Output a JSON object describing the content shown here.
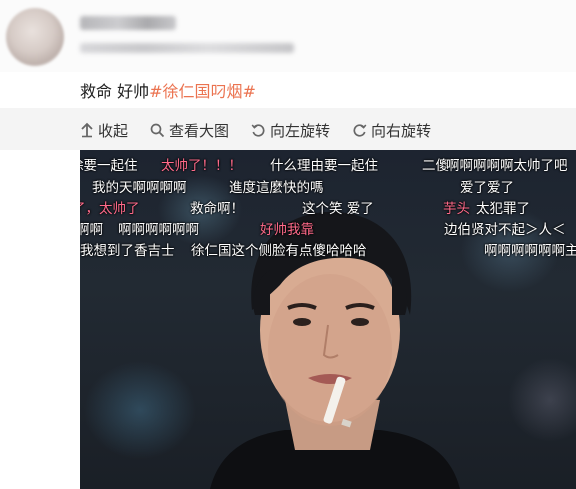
{
  "post": {
    "text": "救命 好帅",
    "hashtag": "#徐仁国叼烟#"
  },
  "toolbar": {
    "collapse_label": "收起",
    "view_large_label": "查看大图",
    "rotate_left_label": "向左旋转",
    "rotate_right_label": "向右旋转",
    "icons": [
      "arrow-up-icon",
      "magnifier-icon",
      "rotate-left-icon",
      "rotate-right-icon"
    ]
  },
  "danmaku": [
    {
      "text": "除要一起住",
      "color": "#ffffff"
    },
    {
      "text": "太帅了！！！",
      "color": "#ff6a8a"
    },
    {
      "text": "什么理由要一起住",
      "color": "#ffffff"
    },
    {
      "text": "二傻",
      "color": "#ffffff"
    },
    {
      "text": "啊啊啊啊啊太帅了吧",
      "color": "#ffffff"
    },
    {
      "text": "我的天啊啊啊啊",
      "color": "#ffffff"
    },
    {
      "text": "進度這麼快的嗎",
      "color": "#ffffff"
    },
    {
      "text": "爱了爱了",
      "color": "#ffffff"
    },
    {
      "text": "了，太帅了",
      "color": "#ff6a8a"
    },
    {
      "text": "救命啊！",
      "color": "#ffffff"
    },
    {
      "text": "这个笑 爱了",
      "color": "#ffffff"
    },
    {
      "text": "芋头",
      "color": "#ff6a8a"
    },
    {
      "text": "太犯罪了",
      "color": "#ffffff"
    },
    {
      "text": "啊啊",
      "color": "#ffffff"
    },
    {
      "text": "啊啊啊啊啊啊",
      "color": "#ffffff"
    },
    {
      "text": "好帅我靠",
      "color": "#ff6a8a"
    },
    {
      "text": "边伯贤对不起＞人＜",
      "color": "#ffffff"
    },
    {
      "text": "我想到了香吉士",
      "color": "#ffffff"
    },
    {
      "text": "徐仁国这个侧脸有点傻哈哈哈",
      "color": "#ffffff"
    },
    {
      "text": "啊啊啊啊啊啊主",
      "color": "#ffffff"
    }
  ]
}
